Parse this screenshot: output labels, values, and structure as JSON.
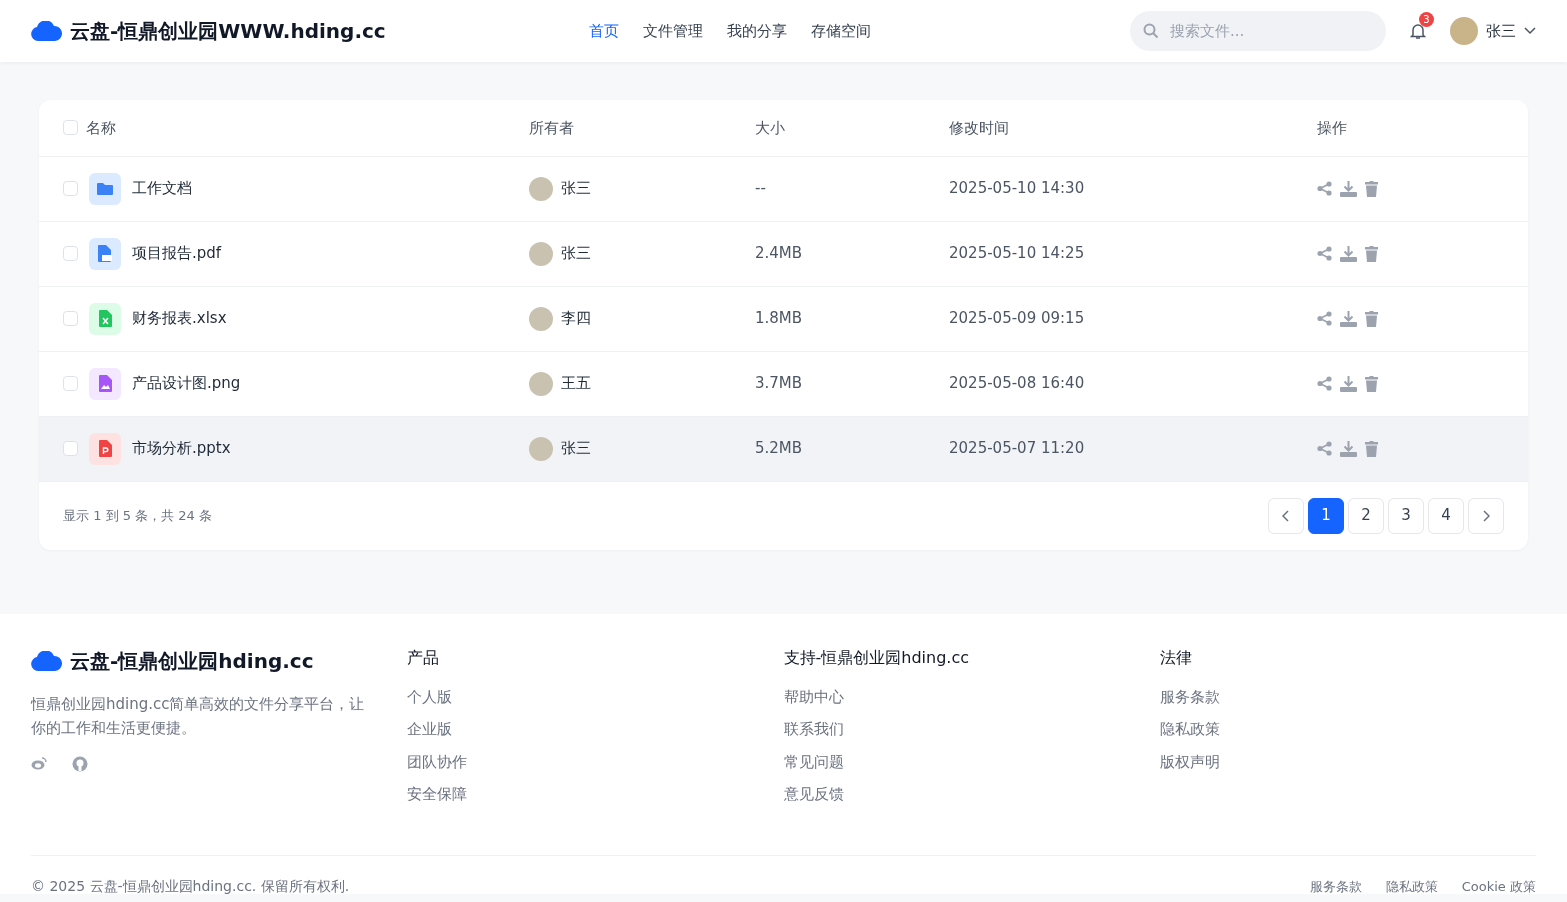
{
  "navbar": {
    "brand": "云盘-恒鼎创业园WWW.hding.cc",
    "links": [
      {
        "label": "首页",
        "selected": true
      },
      {
        "label": "文件管理",
        "selected": false
      },
      {
        "label": "我的分享",
        "selected": false
      },
      {
        "label": "存储空间",
        "selected": false
      }
    ],
    "search": {
      "placeholder": "搜索文件..."
    },
    "notification_count": "3",
    "user": "张三"
  },
  "table": {
    "columns": [
      "名称",
      "所有者",
      "大小",
      "修改时间",
      "操作"
    ],
    "select_all": false,
    "rows": [
      {
        "name": "工作文档",
        "kind": "folder",
        "owner": "张三",
        "size": "--",
        "modified": "2025-05-10 14:30",
        "checked": false,
        "highlighted": false
      },
      {
        "name": "项目报告.pdf",
        "kind": "pdf",
        "owner": "张三",
        "size": "2.4MB",
        "modified": "2025-05-10 14:25",
        "checked": false,
        "highlighted": false
      },
      {
        "name": "财务报表.xlsx",
        "kind": "excel",
        "owner": "李四",
        "size": "1.8MB",
        "modified": "2025-05-09 09:15",
        "checked": false,
        "highlighted": false
      },
      {
        "name": "产品设计图.png",
        "kind": "image",
        "owner": "王五",
        "size": "3.7MB",
        "modified": "2025-05-08 16:40",
        "checked": false,
        "highlighted": false
      },
      {
        "name": "市场分析.pptx",
        "kind": "ppt",
        "owner": "张三",
        "size": "5.2MB",
        "modified": "2025-05-07 11:20",
        "checked": false,
        "highlighted": true
      }
    ],
    "summary": "显示 1 到 5 条，共 24 条",
    "pages": [
      {
        "label": "1",
        "selected": true
      },
      {
        "label": "2",
        "selected": false
      },
      {
        "label": "3",
        "selected": false
      },
      {
        "label": "4",
        "selected": false
      }
    ]
  },
  "footer": {
    "brand": "云盘-恒鼎创业园hding.cc",
    "description": "恒鼎创业园hding.cc简单高效的文件分享平台，让你的工作和生活更便捷。",
    "columns": [
      {
        "title": "产品",
        "links": [
          "个人版",
          "企业版",
          "团队协作",
          "安全保障"
        ]
      },
      {
        "title": "支持-恒鼎创业园hding.cc",
        "links": [
          "帮助中心",
          "联系我们",
          "常见问题",
          "意见反馈"
        ]
      },
      {
        "title": "法律",
        "links": [
          "服务条款",
          "隐私政策",
          "版权声明"
        ]
      }
    ],
    "copyright": "© 2025 云盘-恒鼎创业园hding.cc. 保留所有权利.",
    "bottom_links": [
      "服务条款",
      "隐私政策",
      "Cookie 政策"
    ]
  }
}
